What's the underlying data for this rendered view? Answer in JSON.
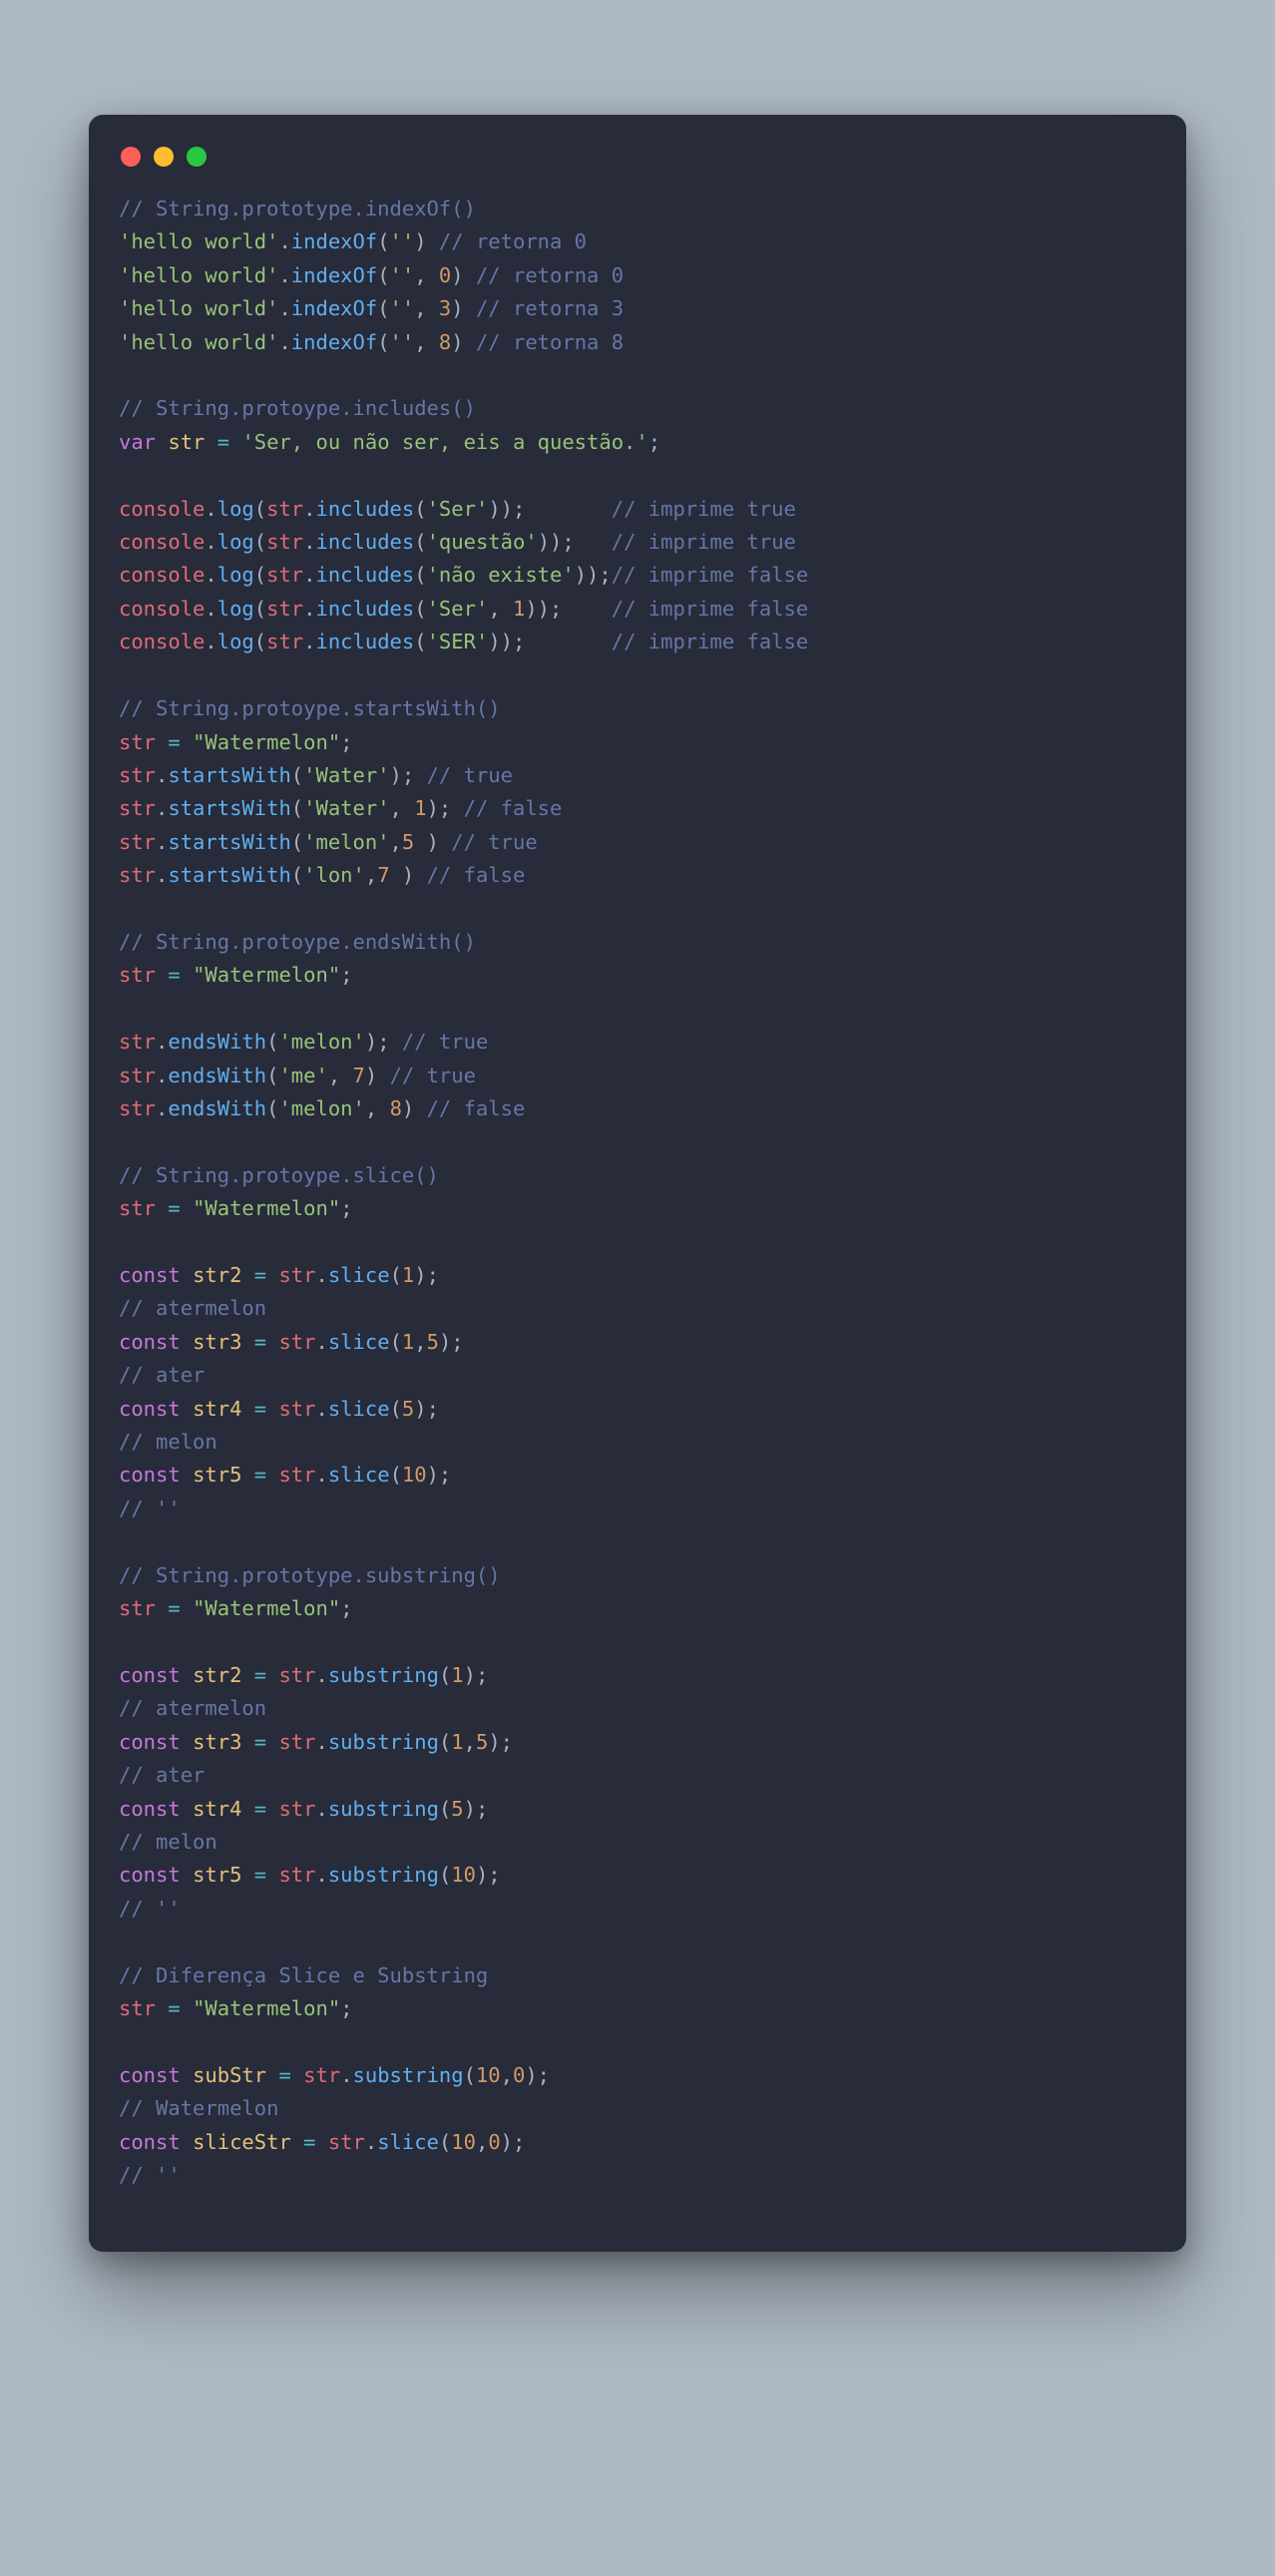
{
  "dots": {
    "red": "#ff5f57",
    "yellow": "#febc2e",
    "green": "#28c840"
  },
  "code": {
    "c1": "// String.prototype.indexOf()",
    "l2a": "'hello world'",
    "l2b": "indexOf",
    "l2c": "''",
    "l2d": "// retorna 0",
    "l3a": "'hello world'",
    "l3b": "indexOf",
    "l3c": "''",
    "l3n": "0",
    "l3d": "// retorna 0",
    "l4a": "'hello world'",
    "l4b": "indexOf",
    "l4c": "''",
    "l4n": "3",
    "l4d": "// retorna 3",
    "l5a": "'hello world'",
    "l5b": "indexOf",
    "l5c": "''",
    "l5n": "8",
    "l5d": "// retorna 8",
    "c2": "// String.protoype.includes()",
    "kvar": "var",
    "vstr": "str",
    "sSer": "'Ser, ou não ser, eis a questão.'",
    "console": "console",
    "log": "log",
    "includes": "includes",
    "sS": "'Ser'",
    "cT1": "// imprime true",
    "sQ": "'questão'",
    "cT2": "// imprime true",
    "sNE": "'não existe'",
    "cF1": "// imprime false",
    "n1": "1",
    "cF2": "// imprime false",
    "sSER": "'SER'",
    "cF3": "// imprime false",
    "c3": "// String.protoype.startsWith()",
    "sWm": "\"Watermelon\"",
    "startsWith": "startsWith",
    "sWater": "'Water'",
    "cTrue": "// true",
    "cFalse": "// false",
    "n5": "5",
    "sMelon": "'melon'",
    "n7": "7",
    "sLon": "'lon'",
    "c4": "// String.protoype.endsWith()",
    "endsWith": "endsWith",
    "sMe": "'me'",
    "n8": "8",
    "c5": "// String.protoype.slice()",
    "kconst": "const",
    "slice": "slice",
    "v2": "str2",
    "v3": "str3",
    "v4": "str4",
    "v5": "str5",
    "cAter": "// atermelon",
    "cAterS": "// ater",
    "cMelon": "// melon",
    "cEE": "// ''",
    "n10": "10",
    "c6": "// String.prototype.substring()",
    "substring": "substring",
    "c7": "// Diferença Slice e Substring",
    "vSub": "subStr",
    "vSlice": "sliceStr",
    "n0": "0",
    "cWm": "// Watermelon"
  }
}
